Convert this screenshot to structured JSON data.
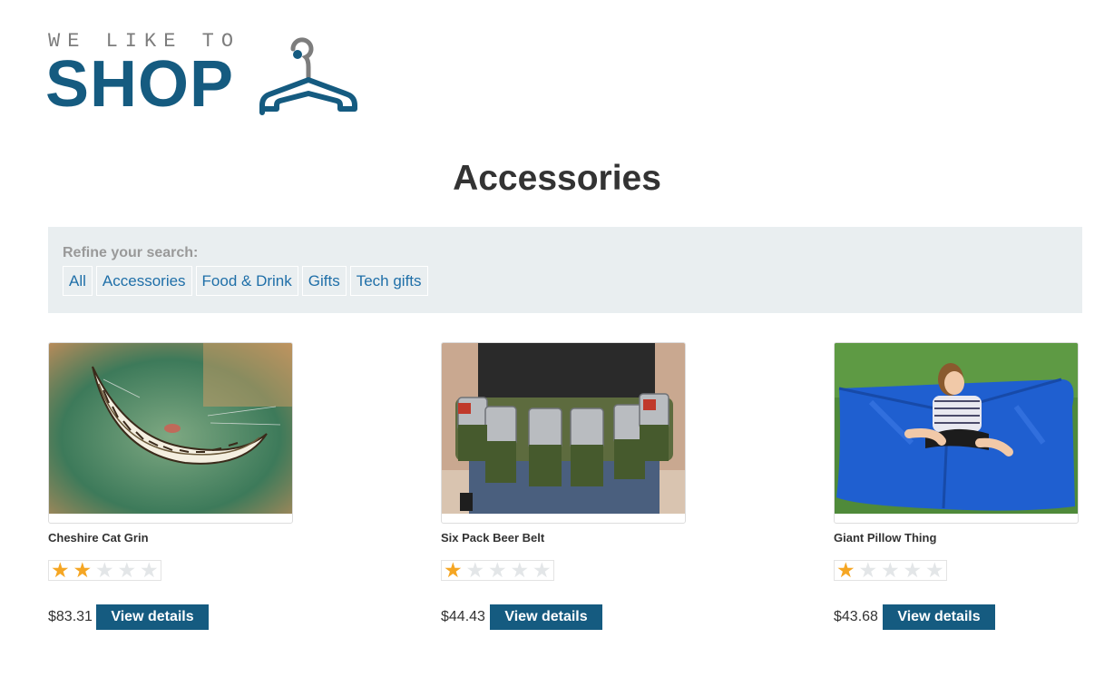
{
  "logo": {
    "top_text": "WE LIKE TO",
    "main_text": "SHOP"
  },
  "page_title": "Accessories",
  "filters": {
    "heading": "Refine your search:",
    "links": [
      "All",
      "Accessories",
      "Food & Drink",
      "Gifts",
      "Tech gifts"
    ]
  },
  "products": [
    {
      "name": "Cheshire Cat Grin",
      "rating": 2,
      "price": "$83.31",
      "button": "View details"
    },
    {
      "name": "Six Pack Beer Belt",
      "rating": 1,
      "price": "$44.43",
      "button": "View details"
    },
    {
      "name": "Giant Pillow Thing",
      "rating": 1,
      "price": "$43.68",
      "button": "View details"
    }
  ],
  "colors": {
    "brand": "#155b80",
    "link": "#1f6fa8",
    "star_filled": "#f5a623",
    "star_empty": "#e3e6e8",
    "filter_bg": "#e9eef0"
  },
  "icons": [
    "hanger-icon",
    "star-icon"
  ]
}
